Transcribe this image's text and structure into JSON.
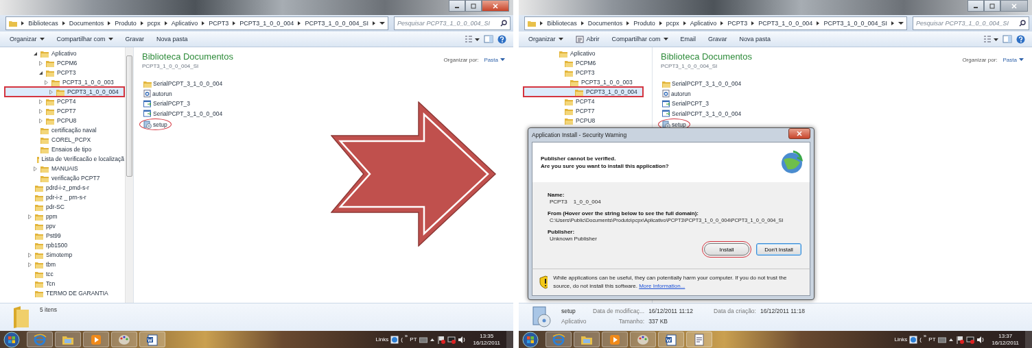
{
  "screens": [
    {
      "window": {
        "active": true
      },
      "breadcrumb": [
        "Bibliotecas",
        "Documentos",
        "Produto",
        "pcpx",
        "Aplicativo",
        "PCPT3",
        "PCPT3_1_0_0_004",
        "PCPT3_1_0_0_004_SI"
      ],
      "search": {
        "placeholder": "Pesquisar PCPT3_1_0_0_004_SI"
      },
      "toolbar": [
        {
          "label": "Organizar",
          "dropdown": true,
          "has_icon": false
        },
        {
          "label": "Compartilhar com",
          "dropdown": true,
          "has_icon": false
        },
        {
          "label": "Gravar",
          "dropdown": false,
          "has_icon": false
        },
        {
          "label": "Nova pasta",
          "dropdown": false,
          "has_icon": false
        }
      ],
      "tree": [
        {
          "children": [
            {
              "label": "Aplicativo",
              "selected": false,
              "expanded": true,
              "children": [
                {
                  "label": "PCPM6",
                  "selected": false,
                  "expanded": false
                },
                {
                  "label": "PCPT3",
                  "selected": false,
                  "expanded": true,
                  "children": [
                    {
                      "label": "PCPT3_1_0_0_003",
                      "selected": false,
                      "expanded": false
                    },
                    {
                      "label": "PCPT3_1_0_0_004",
                      "selected": true,
                      "expanded": false
                    }
                  ]
                },
                {
                  "label": "PCPT4",
                  "selected": false,
                  "expanded": false
                },
                {
                  "label": "PCPT7",
                  "selected": false,
                  "expanded": false
                },
                {
                  "label": "PCPU8",
                  "selected": false,
                  "expanded": false
                }
              ]
            },
            {
              "label": "certificação naval",
              "selected": false
            },
            {
              "label": "COREL_PCPX",
              "selected": false
            },
            {
              "label": "Ensaios de tipo",
              "selected": false
            },
            {
              "label": "Lista de Verificacão e localizaçã",
              "selected": false
            },
            {
              "label": "MANUAIS",
              "selected": false,
              "expanded": false
            },
            {
              "label": "verificação PCPT7",
              "selected": false
            }
          ]
        },
        {
          "label": "pdrd-i-z_pmd-s-r",
          "selected": false
        },
        {
          "label": "pdr-i-z _ prn-s-r",
          "selected": false
        },
        {
          "label": "pdr-SC",
          "selected": false
        },
        {
          "label": "ppm",
          "selected": false,
          "expanded": false
        },
        {
          "label": "ppv",
          "selected": false
        },
        {
          "label": "Pst99",
          "selected": false
        },
        {
          "label": "rpb1500",
          "selected": false
        },
        {
          "label": "Simotemp",
          "selected": false,
          "expanded": false
        },
        {
          "label": "tbm",
          "selected": false,
          "expanded": false
        },
        {
          "label": "tcc",
          "selected": false
        },
        {
          "label": "Tcn",
          "selected": false
        },
        {
          "label": "TERMO DE GARANTIA",
          "selected": false
        }
      ],
      "library": {
        "title": "Biblioteca Documentos",
        "subtitle": "PCPT3_1_0_0_004_SI",
        "arrange_label": "Organizar por:",
        "arrange_value": "Pasta"
      },
      "files": [
        {
          "name": "SerialPCPT_3_1_0_0_004",
          "kind": "folder",
          "circled": false
        },
        {
          "name": "autorun",
          "kind": "script",
          "circled": false
        },
        {
          "name": "SerialPCPT_3",
          "kind": "program",
          "circled": false
        },
        {
          "name": "SerialPCPT_3_1_0_0_004",
          "kind": "program",
          "circled": false
        },
        {
          "name": "setup",
          "kind": "installer",
          "circled": true
        }
      ],
      "details": {
        "kind": "folder",
        "summary": "5 itens"
      },
      "taskbar": {
        "apps": [
          {
            "kind": "browser"
          },
          {
            "kind": "explorer"
          },
          {
            "kind": "media"
          },
          {
            "kind": "paint"
          },
          {
            "kind": "word"
          }
        ],
        "links": "Links",
        "fragment": "(",
        "chevron": "»",
        "language": "PT",
        "time": "13:35",
        "date": "16/12/2011"
      }
    },
    {
      "window": {
        "active": false
      },
      "breadcrumb": [
        "Bibliotecas",
        "Documentos",
        "Produto",
        "pcpx",
        "Aplicativo",
        "PCPT3",
        "PCPT3_1_0_0_004",
        "PCPT3_1_0_0_004_SI"
      ],
      "search": {
        "placeholder": "Pesquisar PCPT3_1_0_0_004_SI"
      },
      "toolbar": [
        {
          "label": "Organizar",
          "dropdown": true,
          "has_icon": false
        },
        {
          "label": "Abrir",
          "dropdown": false,
          "has_icon": true
        },
        {
          "label": "Compartilhar com",
          "dropdown": true,
          "has_icon": false
        },
        {
          "label": "Email",
          "dropdown": false,
          "has_icon": false
        },
        {
          "label": "Gravar",
          "dropdown": false,
          "has_icon": false
        },
        {
          "label": "Nova pasta",
          "dropdown": false,
          "has_icon": false
        }
      ],
      "tree": [
        {
          "children": [
            {
              "label": "Aplicativo",
              "selected": false,
              "children": [
                {
                  "label": "PCPM6",
                  "selected": false
                },
                {
                  "label": "PCPT3",
                  "selected": false,
                  "children": [
                    {
                      "label": "PCPT3_1_0_0_003",
                      "selected": false
                    },
                    {
                      "label": "PCPT3_1_0_0_004",
                      "selected": true
                    }
                  ]
                },
                {
                  "label": "PCPT4",
                  "selected": false
                },
                {
                  "label": "PCPT7",
                  "selected": false
                },
                {
                  "label": "PCPU8",
                  "selected": false
                }
              ]
            }
          ]
        }
      ],
      "library": {
        "title": "Biblioteca Documentos",
        "subtitle": "PCPT3_1_0_0_004_SI",
        "arrange_label": "Organizar por:",
        "arrange_value": "Pasta"
      },
      "files": [
        {
          "name": "SerialPCPT_3_1_0_0_004",
          "kind": "folder",
          "circled": false
        },
        {
          "name": "autorun",
          "kind": "script",
          "circled": false
        },
        {
          "name": "SerialPCPT_3",
          "kind": "program",
          "circled": false
        },
        {
          "name": "SerialPCPT_3_1_0_0_004",
          "kind": "program",
          "circled": false
        },
        {
          "name": "setup",
          "kind": "installer",
          "circled": true
        }
      ],
      "details": {
        "kind": "installer",
        "name": "setup",
        "type": "Aplicativo",
        "fields": [
          {
            "label": "Data de modificaç...",
            "value": "16/12/2011 11:12"
          },
          {
            "label": "Tamanho:",
            "value": "337 KB"
          },
          {
            "label": "Data da criação:",
            "value": "16/12/2011 11:18"
          }
        ]
      },
      "taskbar": {
        "apps": [
          {
            "kind": "browser"
          },
          {
            "kind": "explorer"
          },
          {
            "kind": "media"
          },
          {
            "kind": "paint"
          },
          {
            "kind": "word"
          },
          {
            "kind": "document"
          }
        ],
        "links": "Links",
        "fragment": "(",
        "chevron": "»",
        "language": "PT",
        "time": "13:37",
        "date": "16/12/2011"
      },
      "dialog": {
        "title": "Application Install - Security Warning",
        "heading": [
          "Publisher cannot be verified.",
          "Are you sure you want to install this application?"
        ],
        "fields": [
          {
            "label": "Name:",
            "value": "PCPT3    1_0_0_004"
          },
          {
            "label": "From (Hover over the string below to see the full domain):",
            "value": "C:\\Users\\Public\\Documents\\Produto\\pcpx\\Aplicativo\\PCPT3\\PCPT3_1_0_0_004\\PCPT3_1_0_0_004_SI"
          },
          {
            "label": "Publisher:",
            "value": "Unknown Publisher"
          }
        ],
        "buttons": [
          {
            "label": "Install",
            "circled": true,
            "focused": false
          },
          {
            "label": "Don't Install",
            "circled": false,
            "focused": true
          }
        ],
        "warning": "While applications can be useful, they can potentially harm your computer. If you do not trust the source, do not install this software.",
        "link": "More Information..."
      }
    }
  ]
}
